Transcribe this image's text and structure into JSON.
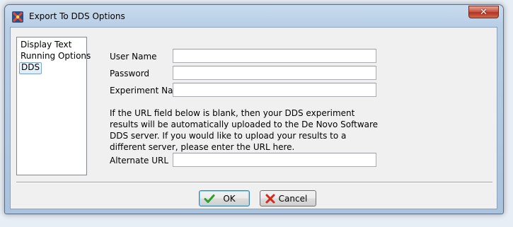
{
  "window": {
    "title": "Export To DDS Options",
    "close_glyph": "✕"
  },
  "sidebar": {
    "items": [
      {
        "label": "Display Text"
      },
      {
        "label": "Running Options"
      },
      {
        "label": "DDS"
      }
    ]
  },
  "form": {
    "user_name": {
      "label": "User Name",
      "value": ""
    },
    "password": {
      "label": "Password",
      "value": ""
    },
    "experiment_name": {
      "label": "Experiment Name",
      "value": ""
    },
    "info_text": "If the URL field below is blank, then your DDS experiment results will be automatically uploaded to the De Novo Software DDS server.  If you would like to upload your results to a different server, please enter the URL here.",
    "alternate_url": {
      "label": "Alternate URL",
      "value": ""
    }
  },
  "buttons": {
    "ok": "OK",
    "cancel": "Cancel"
  },
  "colors": {
    "ok_check": "#2e9e2e",
    "cancel_x": "#d42a1c",
    "selection": "#dcebfc"
  },
  "icons": {
    "app": "app-logo-icon",
    "ok": "checkmark-icon",
    "cancel": "x-mark-icon",
    "close": "close-icon"
  }
}
